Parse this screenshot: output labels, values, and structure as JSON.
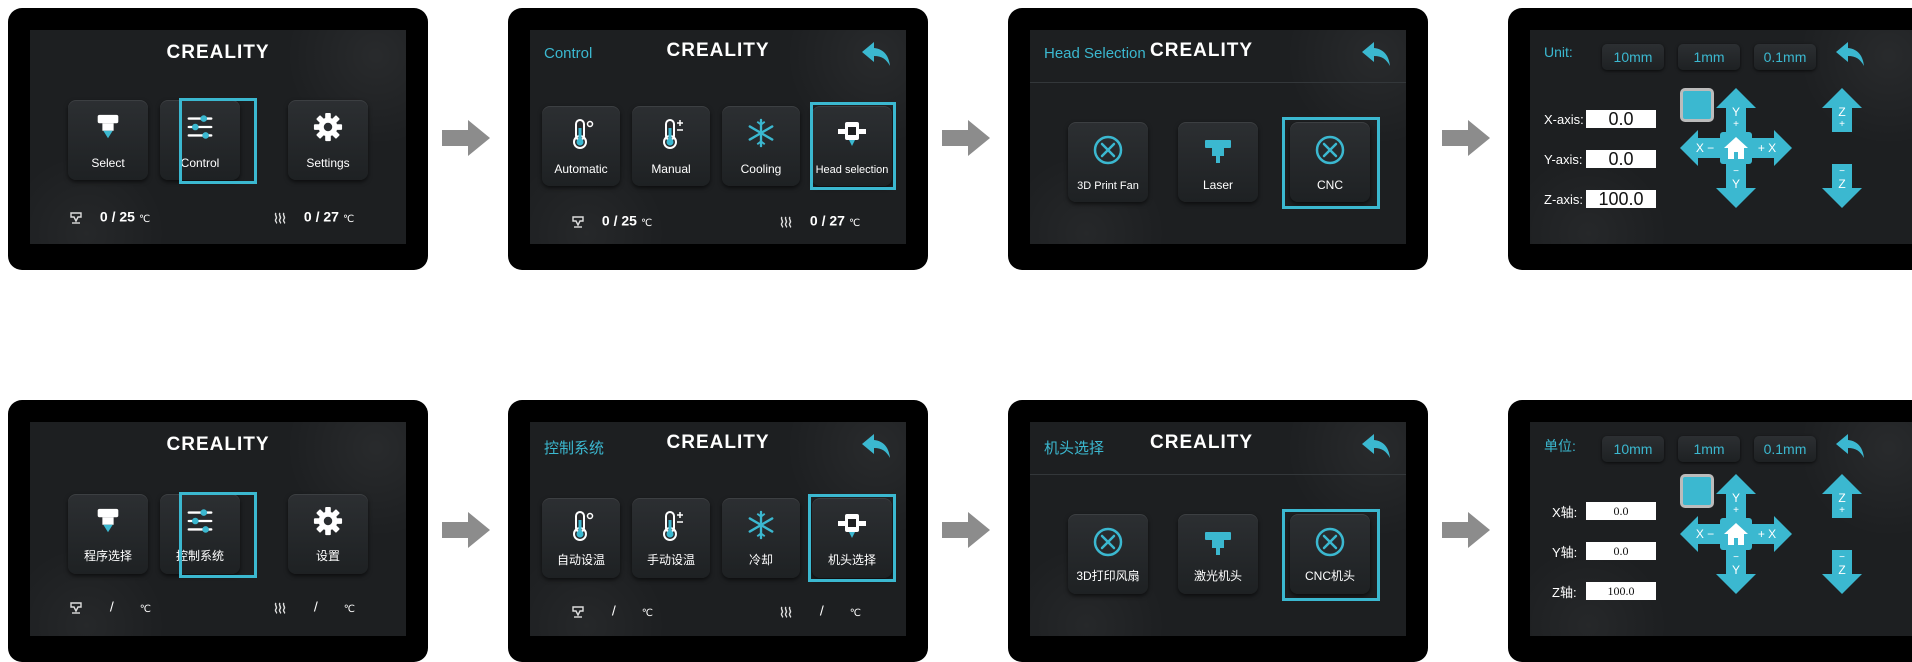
{
  "brand": "CREALITY",
  "colors": {
    "accent": "#3bb8d0",
    "screen_bg": "#1d1f21",
    "bezel": "#000000",
    "arrow": "#8c8c8c"
  },
  "home_en": {
    "tiles": [
      "Select",
      "Control",
      "Settings"
    ],
    "nozzle_temp": {
      "current": "0",
      "target": "25",
      "unit": "℃"
    },
    "bed_temp": {
      "current": "0",
      "target": "27",
      "unit": "℃"
    }
  },
  "control_en": {
    "title": "Control",
    "tiles": [
      "Automatic",
      "Manual",
      "Cooling",
      "Head selection"
    ],
    "nozzle_temp": {
      "current": "0",
      "target": "25",
      "unit": "℃"
    },
    "bed_temp": {
      "current": "0",
      "target": "27",
      "unit": "℃"
    }
  },
  "head_en": {
    "title": "Head Selection",
    "tiles": [
      "3D Print Fan",
      "Laser",
      "CNC"
    ]
  },
  "move_en": {
    "unit_label": "Unit:",
    "units": [
      "10mm",
      "1mm",
      "0.1mm"
    ],
    "axes": [
      {
        "label": "X-axis:",
        "value": "0.0"
      },
      {
        "label": "Y-axis:",
        "value": "0.0"
      },
      {
        "label": "Z-axis:",
        "value": "100.0"
      }
    ]
  },
  "home_zh": {
    "tiles": [
      "程序选择",
      "控制系统",
      "设置"
    ],
    "nozzle_temp": {
      "sep": "/",
      "unit": "℃"
    },
    "bed_temp": {
      "sep": "/",
      "unit": "℃"
    }
  },
  "control_zh": {
    "title": "控制系统",
    "tiles": [
      "自动设温",
      "手动设温",
      "冷却",
      "机头选择"
    ],
    "nozzle_temp": {
      "sep": "/",
      "unit": "℃"
    },
    "bed_temp": {
      "sep": "/",
      "unit": "℃"
    }
  },
  "head_zh": {
    "title": "机头选择",
    "tiles": [
      "3D打印风扇",
      "激光机头",
      "CNC机头"
    ]
  },
  "move_zh": {
    "unit_label": "单位:",
    "units": [
      "10mm",
      "1mm",
      "0.1mm"
    ],
    "axes": [
      {
        "label": "X轴:",
        "value": "0.0"
      },
      {
        "label": "Y轴:",
        "value": "0.0"
      },
      {
        "label": "Z轴:",
        "value": "100.0"
      }
    ]
  },
  "jog_labels": {
    "y_plus": "Y",
    "y_minus": "Y",
    "x_minus": "X −",
    "x_plus": "+ X",
    "z_plus": "Z",
    "z_minus": "Z",
    "plus": "+",
    "minus": "−"
  },
  "icons": [
    "nozzle-icon",
    "sliders-icon",
    "gear-icon",
    "thermometer-icon",
    "snowflake-icon",
    "print-head-icon",
    "fan-x-icon",
    "laser-head-icon",
    "back-arrow-icon",
    "home-icon",
    "bed-heat-icon",
    "nozzle-temp-icon"
  ]
}
